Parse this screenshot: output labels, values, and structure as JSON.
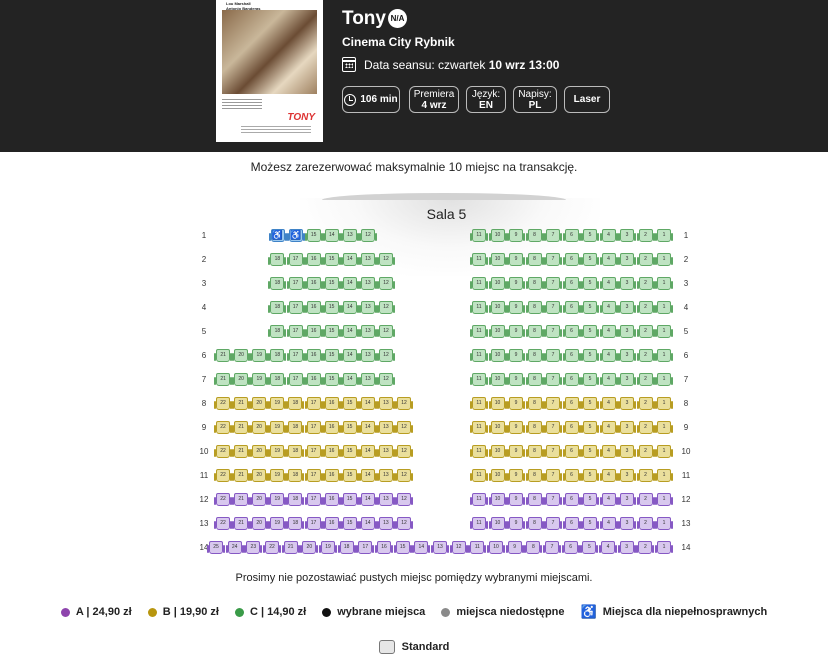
{
  "header": {
    "title": "Tony",
    "age_rating": "N/A",
    "cinema": "Cinema City Rybnik",
    "date_label": "Data seansu: czwartek",
    "date_value": "10 wrz 13:00",
    "duration": "106 min",
    "premiere_label": "Premiera",
    "premiere_value": "4 wrz",
    "language_label": "Język:",
    "language_value": "EN",
    "subtitles_label": "Napisy:",
    "subtitles_value": "PL",
    "format": "Laser"
  },
  "poster": {
    "actors": [
      "Lou Marshall",
      "Antonio Banderas"
    ],
    "logo": "TONY"
  },
  "max_note": "Możesz zarezerwować maksymalnie 10 miejsc na transakcję.",
  "hall": {
    "name": "Sala 5"
  },
  "seating": {
    "rows": [
      {
        "row": "1",
        "left": [
          {
            "label": "♿",
            "cls": "w"
          },
          {
            "label": "♿",
            "cls": "w"
          },
          {
            "label": "15",
            "cls": "c"
          },
          {
            "label": "14",
            "cls": "c"
          },
          {
            "label": "13",
            "cls": "c"
          },
          {
            "label": "12",
            "cls": "c"
          }
        ],
        "right_labels": [
          "11",
          "10",
          "9",
          "8",
          "7",
          "6",
          "5",
          "4",
          "3",
          "2",
          "1"
        ],
        "right_cls": "c"
      },
      {
        "row": "2",
        "left_labels": [
          "18",
          "17",
          "16",
          "15",
          "14",
          "13",
          "12"
        ],
        "right_labels": [
          "11",
          "10",
          "9",
          "8",
          "7",
          "6",
          "5",
          "4",
          "3",
          "2",
          "1"
        ],
        "cls": "c"
      },
      {
        "row": "3",
        "left_labels": [
          "18",
          "17",
          "16",
          "15",
          "14",
          "13",
          "12"
        ],
        "right_labels": [
          "11",
          "10",
          "9",
          "8",
          "7",
          "6",
          "5",
          "4",
          "3",
          "2",
          "1"
        ],
        "cls": "c"
      },
      {
        "row": "4",
        "left_labels": [
          "18",
          "17",
          "16",
          "15",
          "14",
          "13",
          "12"
        ],
        "right_labels": [
          "11",
          "10",
          "9",
          "8",
          "7",
          "6",
          "5",
          "4",
          "3",
          "2",
          "1"
        ],
        "cls": "c"
      },
      {
        "row": "5",
        "left_labels": [
          "18",
          "17",
          "16",
          "15",
          "14",
          "13",
          "12"
        ],
        "right_labels": [
          "11",
          "10",
          "9",
          "8",
          "7",
          "6",
          "5",
          "4",
          "3",
          "2",
          "1"
        ],
        "cls": "c"
      },
      {
        "row": "6",
        "left_labels": [
          "21",
          "20",
          "19",
          "18",
          "17",
          "16",
          "15",
          "14",
          "13",
          "12"
        ],
        "right_labels": [
          "11",
          "10",
          "9",
          "8",
          "7",
          "6",
          "5",
          "4",
          "3",
          "2",
          "1"
        ],
        "cls": "c"
      },
      {
        "row": "7",
        "left_labels": [
          "21",
          "20",
          "19",
          "18",
          "17",
          "16",
          "15",
          "14",
          "13",
          "12"
        ],
        "right_labels": [
          "11",
          "10",
          "9",
          "8",
          "7",
          "6",
          "5",
          "4",
          "3",
          "2",
          "1"
        ],
        "cls": "c"
      },
      {
        "row": "8",
        "left_labels": [
          "22",
          "21",
          "20",
          "19",
          "18",
          "17",
          "16",
          "15",
          "14",
          "13",
          "12"
        ],
        "right_labels": [
          "11",
          "10",
          "9",
          "8",
          "7",
          "6",
          "5",
          "4",
          "3",
          "2",
          "1"
        ],
        "cls": "b"
      },
      {
        "row": "9",
        "left_labels": [
          "22",
          "21",
          "20",
          "19",
          "18",
          "17",
          "16",
          "15",
          "14",
          "13",
          "12"
        ],
        "right_labels": [
          "11",
          "10",
          "9",
          "8",
          "7",
          "6",
          "5",
          "4",
          "3",
          "2",
          "1"
        ],
        "cls": "b"
      },
      {
        "row": "10",
        "left_labels": [
          "22",
          "21",
          "20",
          "19",
          "18",
          "17",
          "16",
          "15",
          "14",
          "13",
          "12"
        ],
        "right_labels": [
          "11",
          "10",
          "9",
          "8",
          "7",
          "6",
          "5",
          "4",
          "3",
          "2",
          "1"
        ],
        "cls": "b"
      },
      {
        "row": "11",
        "left_labels": [
          "22",
          "21",
          "20",
          "19",
          "18",
          "17",
          "16",
          "15",
          "14",
          "13",
          "12"
        ],
        "right_labels": [
          "11",
          "10",
          "9",
          "8",
          "7",
          "6",
          "5",
          "4",
          "3",
          "2",
          "1"
        ],
        "cls": "b"
      },
      {
        "row": "12",
        "left_labels": [
          "22",
          "21",
          "20",
          "19",
          "18",
          "17",
          "16",
          "15",
          "14",
          "13",
          "12"
        ],
        "right_labels": [
          "11",
          "10",
          "9",
          "8",
          "7",
          "6",
          "5",
          "4",
          "3",
          "2",
          "1"
        ],
        "cls": "a"
      },
      {
        "row": "13",
        "left_labels": [
          "22",
          "21",
          "20",
          "19",
          "18",
          "17",
          "16",
          "15",
          "14",
          "13",
          "12"
        ],
        "right_labels": [
          "11",
          "10",
          "9",
          "8",
          "7",
          "6",
          "5",
          "4",
          "3",
          "2",
          "1"
        ],
        "cls": "a"
      },
      {
        "row": "14",
        "full_labels": [
          "25",
          "24",
          "23",
          "22",
          "21",
          "20",
          "19",
          "18",
          "17",
          "16",
          "15",
          "14",
          "13",
          "12",
          "11",
          "10",
          "9",
          "8",
          "7",
          "6",
          "5",
          "4",
          "3",
          "2",
          "1"
        ],
        "cls": "a"
      }
    ]
  },
  "footer_note": "Prosimy nie pozostawiać pustych miejsc pomiędzy wybranymi miejscami.",
  "legend": [
    {
      "label": "A | 24,90 zł",
      "color": "#8e44ad",
      "kind": "dot"
    },
    {
      "label": "B | 19,90 zł",
      "color": "#b8960f",
      "kind": "dot"
    },
    {
      "label": "C | 14,90 zł",
      "color": "#3a9b48",
      "kind": "dot"
    },
    {
      "label": "wybrane miejsca",
      "color": "#111111",
      "kind": "dot"
    },
    {
      "label": "miejsca niedostępne",
      "color": "#8a8a8a",
      "kind": "dot"
    },
    {
      "label": "Miejsca dla niepełnosprawnych",
      "color": "#3f83c7",
      "kind": "wheelchair-icon"
    }
  ],
  "standard_label": "Standard"
}
